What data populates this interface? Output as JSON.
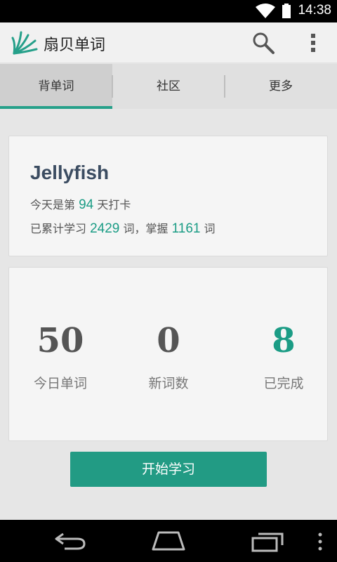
{
  "status_bar": {
    "time": "14:38",
    "icons": [
      "wifi-icon",
      "battery-icon"
    ]
  },
  "app_bar": {
    "title": "扇贝单词",
    "icons": [
      "shanbay-logo-icon",
      "search-icon",
      "overflow-menu-icon"
    ]
  },
  "tabs": [
    {
      "label": "背单词",
      "selected": true
    },
    {
      "label": "社区",
      "selected": false
    },
    {
      "label": "更多",
      "selected": false
    }
  ],
  "profile": {
    "name": "Jellyfish",
    "checkin_prefix": "今天是第",
    "checkin_days": "94",
    "checkin_suffix": "天打卡",
    "total_prefix": "已累计学习",
    "total_words": "2429",
    "total_mid": "词，掌握",
    "mastered_words": "1161",
    "total_suffix": "词"
  },
  "stats": [
    {
      "value": "50",
      "label": "今日单词"
    },
    {
      "value": "0",
      "label": "新词数"
    },
    {
      "value": "8",
      "label": "已完成"
    }
  ],
  "start_button": {
    "label": "开始学习"
  },
  "nav_bar": {
    "icons": [
      "back-icon",
      "home-icon",
      "recents-icon",
      "menu-icon"
    ]
  },
  "colors": {
    "accent": "#26a08a",
    "accent_text": "#1b9c85",
    "button": "#229b84",
    "name": "#3b4c61"
  }
}
